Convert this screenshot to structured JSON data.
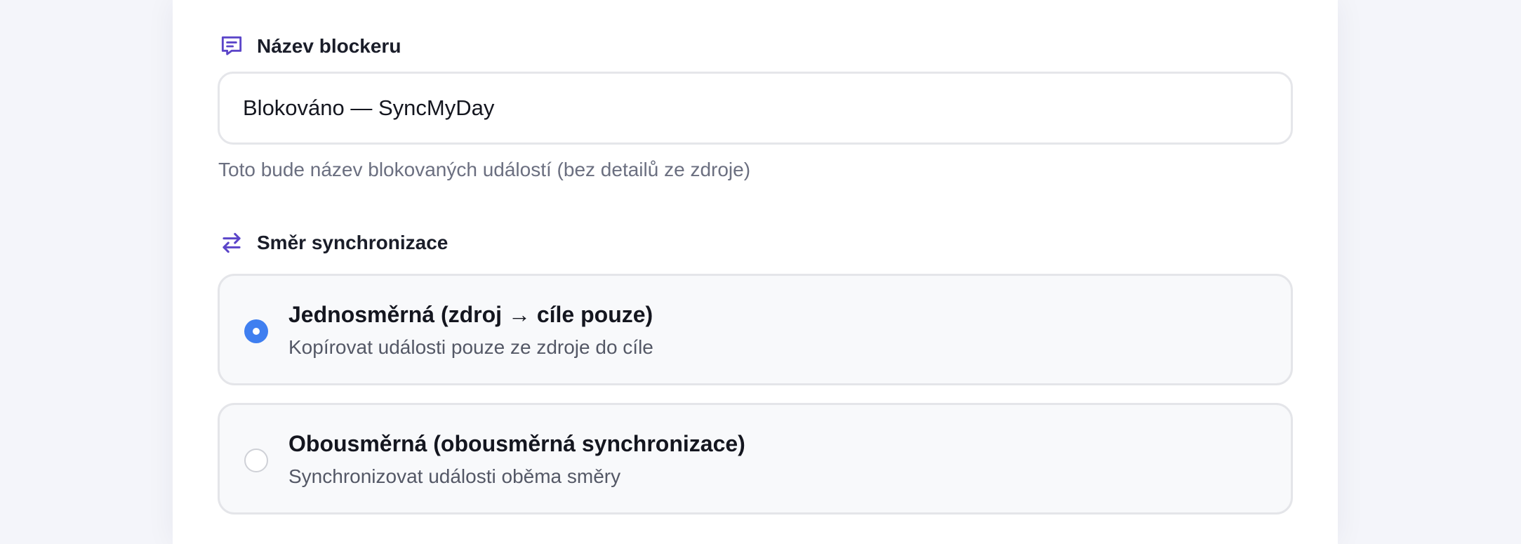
{
  "blocker_name": {
    "label": "Název blockeru",
    "icon": "message-icon",
    "value": "Blokováno — SyncMyDay",
    "helper": "Toto bude název blokovaných událostí (bez detailů ze zdroje)"
  },
  "sync_direction": {
    "label": "Směr synchronizace",
    "icon": "arrows-swap-icon",
    "options": [
      {
        "title": "Jednosměrná (zdroj → cíle pouze)",
        "description": "Kopírovat události pouze ze zdroje do cíle",
        "selected": true
      },
      {
        "title": "Obousměrná (obousměrná synchronizace)",
        "description": "Synchronizovat události oběma směry",
        "selected": false
      }
    ]
  },
  "colors": {
    "accent": "#3f7ff0",
    "icon": "#5b45c9",
    "text": "#14161f",
    "muted": "#6b6f80"
  }
}
